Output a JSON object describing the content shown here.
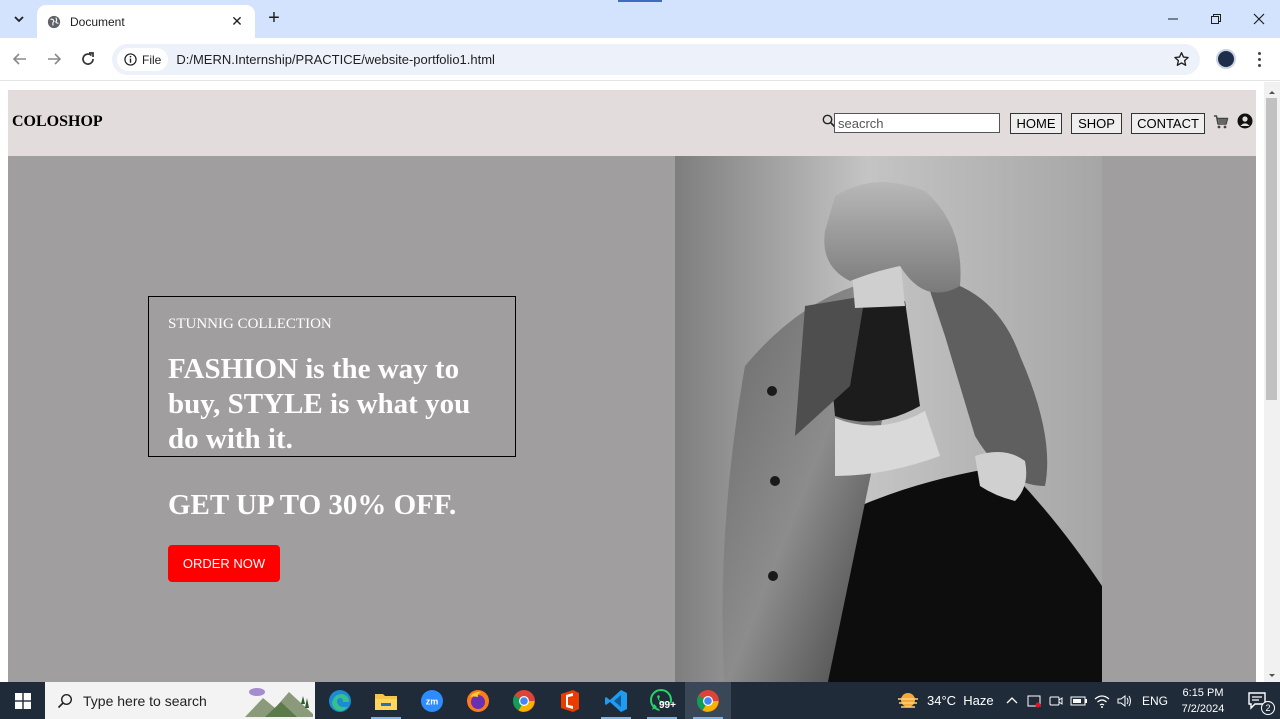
{
  "browser": {
    "tab_title": "Document",
    "file_chip_label": "File",
    "url": "D:/MERN.Internship/PRACTICE/website-portfolio1.html",
    "icons": [
      "tab-dropdown-icon",
      "globe-icon",
      "close-icon",
      "plus-icon",
      "minimize-icon",
      "restore-icon",
      "close-window-icon",
      "back-icon",
      "forward-icon",
      "reload-icon",
      "info-icon",
      "star-icon",
      "kebab-menu-icon"
    ]
  },
  "site": {
    "logo": "COLOSHOP",
    "search_placeholder": "seacrch",
    "nav": [
      "HOME",
      "SHOP",
      "CONTACT"
    ],
    "hero": {
      "kicker": "STUNNIG COLLECTION",
      "headline": "FASHION is the way to buy, STYLE is what you do with it.",
      "offer": "GET UP TO 30% OFF.",
      "cta": "ORDER NOW"
    },
    "colors": {
      "header_bg": "#e2dcdd",
      "hero_bg": "#a09e9f",
      "cta_bg": "#ff0000"
    }
  },
  "taskbar": {
    "search_placeholder": "Type here to search",
    "weather": "34°C  Haze",
    "language": "ENG",
    "time": "6:15 PM",
    "date": "7/2/2024",
    "whatsapp_badge": "99+",
    "notification_count": "2",
    "apps": [
      "edge-icon",
      "file-explorer-icon",
      "zoom-icon",
      "firefox-icon",
      "chrome-icon",
      "office-icon",
      "vscode-icon",
      "whatsapp-icon",
      "chrome-icon"
    ]
  }
}
